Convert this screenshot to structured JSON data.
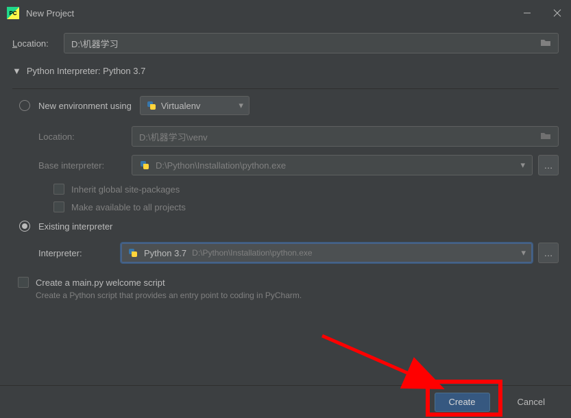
{
  "window": {
    "title": "New Project",
    "icon_label": "PC"
  },
  "location": {
    "label_prefix": "L",
    "label_rest": "ocation:",
    "value": "D:\\机器学习"
  },
  "interpreter_section": {
    "label": "Python Interpreter: Python 3.7"
  },
  "new_env": {
    "label": "New environment using",
    "dropdown_value": "Virtualenv",
    "location_label": "Location:",
    "location_value": "D:\\机器学习\\venv",
    "base_label": "Base interpreter:",
    "base_value": "D:\\Python\\Installation\\python.exe",
    "inherit_label": "Inherit global site-packages",
    "make_available_label": "Make available to all projects"
  },
  "existing": {
    "label": "Existing interpreter",
    "interpreter_label": "Interpreter:",
    "value_primary": "Python 3.7",
    "value_secondary": "D:\\Python\\Installation\\python.exe"
  },
  "welcome": {
    "label": "Create a main.py welcome script",
    "desc": "Create a Python script that provides an entry point to coding in PyCharm."
  },
  "footer": {
    "create": "Create",
    "cancel": "Cancel"
  }
}
